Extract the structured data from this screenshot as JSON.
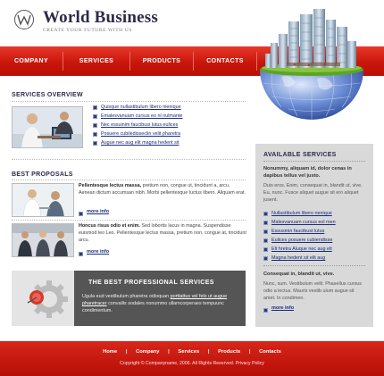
{
  "header": {
    "brand": "World Business",
    "tagline": "CREATE YOUR FUTURE WITH US"
  },
  "nav": {
    "items": [
      {
        "label": "COMPANY"
      },
      {
        "label": "SERVICES"
      },
      {
        "label": "PRODUCTS"
      },
      {
        "label": "CONTACTS"
      }
    ]
  },
  "services_overview": {
    "title": "SERVICES OVERVIEW",
    "links": [
      "Quisque nullastibulum libero nienique",
      "Emalesvanuam cursus eo nl nulmante",
      "Nec essuinim faucibusi lutus eulices",
      "Posuere cubiledisseclin velit pharetra",
      "Augue nec aug elit magna hedent sit"
    ]
  },
  "best_proposals": {
    "title": "BEST PROPOSALS",
    "items": [
      {
        "lead": "Pellentesque lectus massa,",
        "text": " pretium non, congue ut, tincidunt a, arcu. Aenean dictum accumsan nibh. Morbi pellentesque luctus libero. Aliquam erat.",
        "more": "more info"
      },
      {
        "lead": "Honcus risus odio et enim.",
        "text": " Sed lobortis lacus in magna. Suspendisse euismod leo Leo. Pellentesque lectus massa, pretium non, congue at, tincidunt arcu.",
        "more": "more info"
      }
    ]
  },
  "promo": {
    "title": "THE BEST PROFESSIONAL SERVICES",
    "text_pre": "Ugula eud vestibulum pharetra odioquan ",
    "text_link": "porttattus vel felo ut augue pharetracer",
    "text_post": " convallis sodales nonummo ullamcorperaes tempuunc condimentum."
  },
  "sidebar": {
    "title": "AVAILABLE SERVICES",
    "intro_bold": "Nonummy, aliquam id, dolor cenas in dapibus tellus vel justo.",
    "intro_text": "Duis eros. Enim, consequat in, blandit ut, vive. Eu, nunc. Fusce aliquet augue sit ero aliquet jusent.",
    "links": [
      "Nullastibulum libero nenique",
      "Malesvanuam cursus eol men",
      "Essusmin faucibust lutus",
      "Eulices posuere cubiendisse",
      "Elt hretra Aluque nec aug elt",
      "Magna hedent sit elit aug"
    ],
    "outro_bold": "Consequat in, blandit ut, vive.",
    "outro_text": "Nunc, sum. Vestibulum velit. Phasellus cursus odio a lectus. Mauris vestib ulum augue sit amet. In condimen.",
    "more": "more info"
  },
  "footer": {
    "links": [
      "Home",
      "Company",
      "Services",
      "Products",
      "Contacts"
    ],
    "separator": "|",
    "copyright": "Copyright © Companyname, 2006. All Rights Reserved. Privacy Policy"
  },
  "colors": {
    "accent_red": "#c8160b",
    "navy": "#2b2b4a",
    "link_blue": "#1a2d7c",
    "sidebar_gray": "#d9d9d9",
    "promo_gray": "#555555"
  }
}
